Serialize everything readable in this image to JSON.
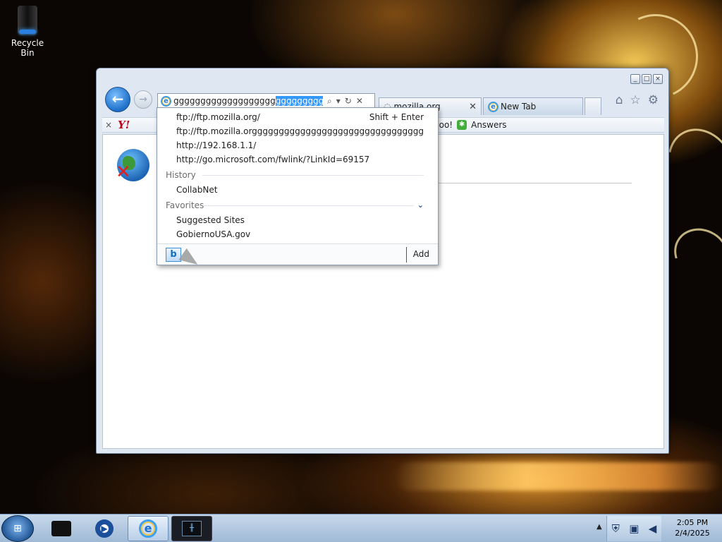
{
  "desktop": {
    "recycle_bin_label": "Recycle Bin"
  },
  "browser": {
    "window_controls": [
      "minimize",
      "restore",
      "close"
    ],
    "address": {
      "text_before_selection": "ggggggggggggggggggg",
      "selected_text": "gggggggggggg",
      "text_after_selection": "/"
    },
    "tabs": [
      {
        "label": "mozilla.org",
        "icon": "loading-icon",
        "closable": true
      },
      {
        "label": "New Tab",
        "icon": "ie-icon",
        "closable": false
      }
    ],
    "favorites_bar": {
      "logo": "Y!",
      "items": [
        "hoo!",
        "Answers"
      ]
    },
    "suggestions": {
      "urls": [
        {
          "text": "ftp://ftp.mozilla.org/",
          "hint": "Shift + Enter"
        },
        {
          "text": "ftp://ftp.mozilla.orgggggggggggggggggggggggggggggggggggg/"
        },
        {
          "text": "http://192.168.1.1/"
        },
        {
          "text": "http://go.microsoft.com/fwlink/?LinkId=69157"
        }
      ],
      "history_label": "History",
      "history": [
        "CollabNet"
      ],
      "favorites_label": "Favorites",
      "favorites": [
        "Suggested Sites",
        "GobiernoUSA.gov"
      ],
      "add_label": "Add",
      "search_provider_icon": "b"
    }
  },
  "taskbar": {
    "items": [
      "explorer",
      "media-player",
      "internet-explorer",
      "monitor"
    ],
    "clock_time": "2:05 PM",
    "clock_date": "2/4/2025"
  }
}
